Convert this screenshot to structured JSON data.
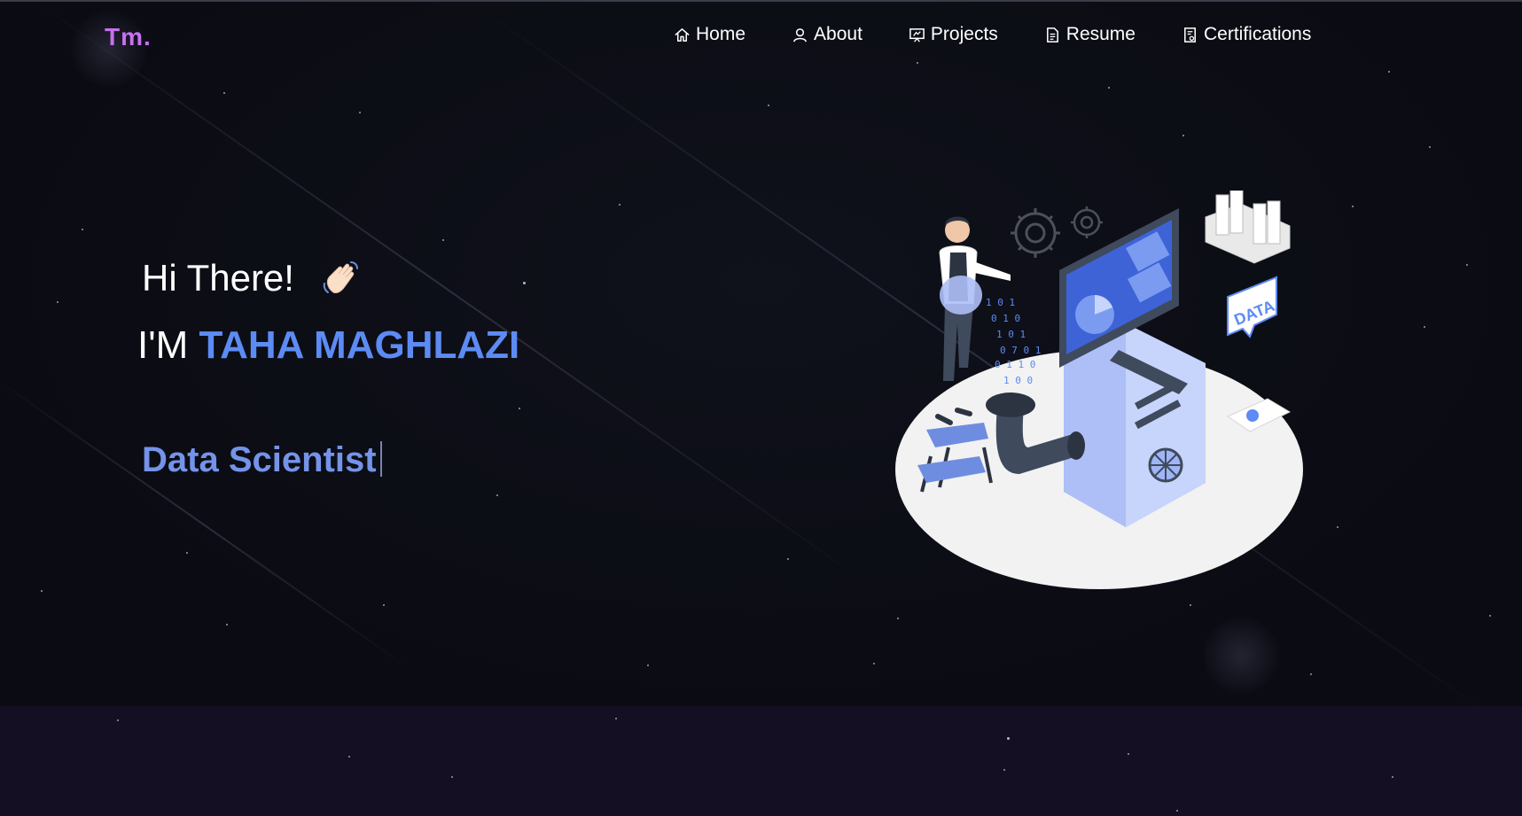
{
  "logo": {
    "text": "Tm."
  },
  "nav": {
    "items": [
      {
        "label": "Home",
        "icon": "home-icon"
      },
      {
        "label": "About",
        "icon": "user-icon"
      },
      {
        "label": "Projects",
        "icon": "projects-icon"
      },
      {
        "label": "Resume",
        "icon": "document-icon"
      },
      {
        "label": "Certifications",
        "icon": "certificate-icon"
      }
    ]
  },
  "hero": {
    "greeting": "Hi There!",
    "greeting_emoji": "waving-hand-icon",
    "intro_prefix": "I'M",
    "name": "TAHA MAGHLAZI",
    "role": "Data Scientist",
    "illustration_label": "DATA"
  },
  "colors": {
    "background": "#0c0d14",
    "lower_section": "#150f24",
    "accent_logo": "#c770f0",
    "accent_name": "#5d8bf4",
    "accent_role": "#7493e9",
    "text": "#ffffff"
  }
}
